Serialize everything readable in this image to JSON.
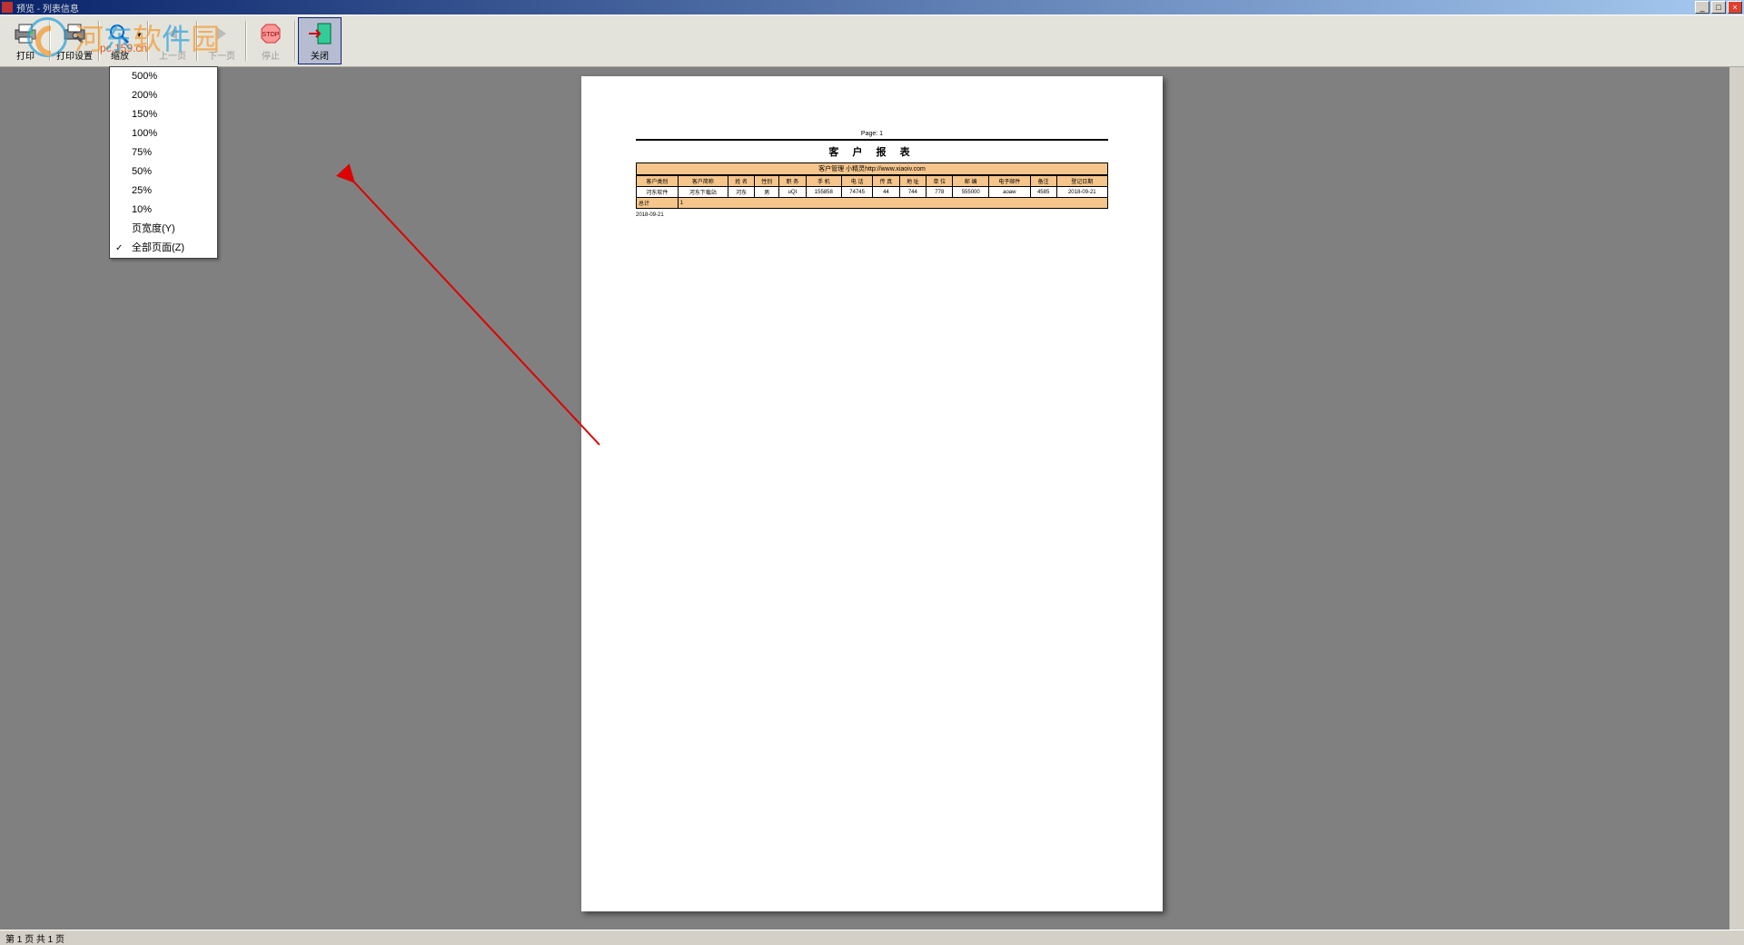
{
  "window": {
    "title": "预览 - 列表信息",
    "min": "_",
    "max": "□",
    "close": "×"
  },
  "toolbar": {
    "print": "打印",
    "printSetup": "打印设置",
    "zoom": "缩放",
    "prev": "上一页",
    "next": "下一页",
    "stop": "停止",
    "close": "关闭"
  },
  "zoomMenu": {
    "items": [
      "500%",
      "200%",
      "150%",
      "100%",
      "75%",
      "50%",
      "25%",
      "10%"
    ],
    "pageWidth": "页宽度(Y)",
    "fullPage": "全部页面(Z)",
    "checked": "全部页面(Z)"
  },
  "report": {
    "pageLabel": "Page: 1",
    "title": "客 户 报 表",
    "subtitle": "客户管理 小精灵http://www.xiaoiv.com",
    "headers": [
      "客户类别",
      "客户简称",
      "姓 名",
      "性别",
      "职 务",
      "手 机",
      "电 话",
      "传 真",
      "地 址",
      "单 位",
      "邮 编",
      "电子邮件",
      "备注",
      "登记日期"
    ],
    "rows": [
      [
        "河东软件",
        "河东下载站",
        "河东",
        "男",
        "uQI",
        "155858",
        "74745",
        "44",
        "744",
        "778",
        "555000",
        "aoaw",
        "4585",
        "2018-09-21"
      ]
    ],
    "totalLabel": "总计",
    "totalVal": "1",
    "date": "2018-09-21"
  },
  "status": {
    "text": "第 1 页 共 1 页"
  },
  "watermark": {
    "chars": [
      "河",
      "东",
      "软",
      "件",
      "园"
    ],
    "url": "pc.159.cn"
  }
}
